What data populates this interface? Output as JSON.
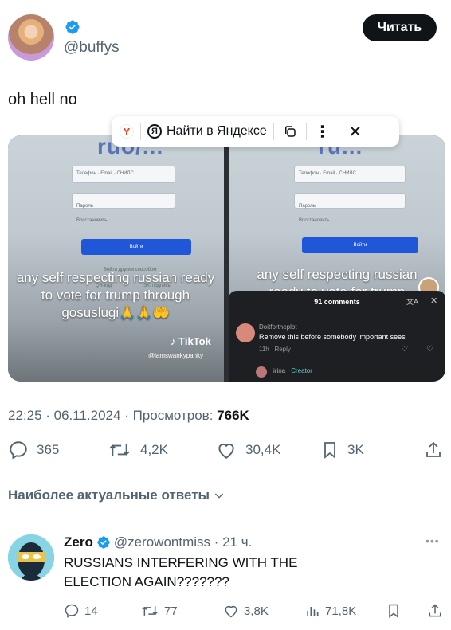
{
  "author": {
    "handle": "@buffys",
    "verified": true,
    "follow_label": "Читать"
  },
  "tweet": {
    "text": "oh hell no",
    "meta_time": "22:25 · 06.11.2024 · Просмотров: ",
    "meta_views": "766K"
  },
  "media": {
    "site_logo_left": "ruo/...",
    "site_logo_right": "ru...",
    "field_placeholder": "Телефон · Email · СНИЛС",
    "password_label": "Пароль",
    "restore_label": "Восстановить",
    "login_button": "Войти",
    "other_login": "Войти другим способом",
    "qr_label": "QR-код",
    "sig_label": "Эл. подпись",
    "caption_left": "any self respecting russian ready to vote for trump through gosuslugi🙏🙏🤲",
    "caption_right_line1": "any self respecting russian",
    "caption_right_line2": "ready to vote for trump",
    "tiktok_label": "TikTok",
    "tiktok_handle": "@iamswankypanky",
    "comments_count": "91 comments",
    "comment1_user": "Doitfortheplot",
    "comment1_text": "Remove this before somebody important sees",
    "comment1_time": "11h",
    "comment1_reply": "Reply",
    "comment2_user": "irina",
    "comment2_badge": "Creator"
  },
  "yandex_popup": {
    "find_label": "Найти в Яндексе"
  },
  "actions": {
    "replies": "365",
    "retweets": "4,2K",
    "likes": "30,4K",
    "bookmarks": "3K"
  },
  "top_replies_label": "Наиболее актуальные ответы",
  "reply": {
    "name": "Zero",
    "handle_time": "@zerowontmiss · 21 ч.",
    "text": "RUSSIANS INTERFERING WITH THE ELECTION AGAIN???????",
    "replies": "14",
    "retweets": "77",
    "likes": "3,8K",
    "views": "71,8K"
  },
  "colors": {
    "accent_blue": "#1d9bf0",
    "text_primary": "#0f1419",
    "text_secondary": "#536471"
  }
}
